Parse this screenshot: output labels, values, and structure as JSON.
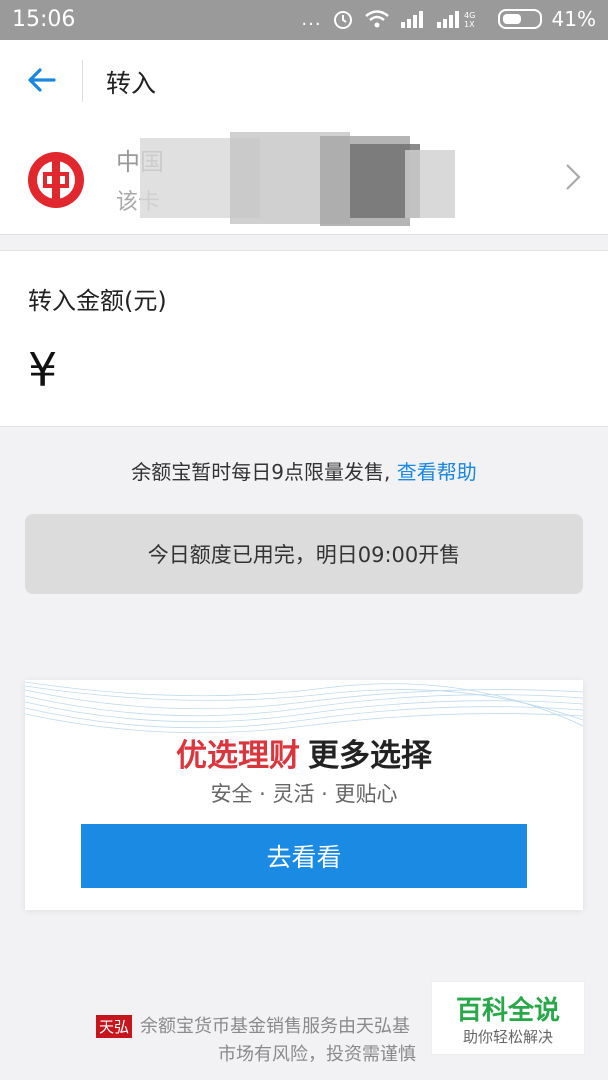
{
  "status_bar": {
    "time": "15:06",
    "dots": "...",
    "network": "4G\n1X",
    "battery": "41%",
    "battery_level": 0.41
  },
  "nav": {
    "title": "转入"
  },
  "bank_card": {
    "name": "中国",
    "sub": "该卡",
    "logo_color": "#e0282e"
  },
  "amount": {
    "label": "转入金额(元)",
    "currency": "¥",
    "value": ""
  },
  "notice": {
    "text": "余额宝暂时每日9点限量发售,",
    "link": "查看帮助"
  },
  "sold_out_button": {
    "label": "今日额度已用完，明日09:00开售"
  },
  "promo": {
    "title_red": "优选理财",
    "title_dark": "更多选择",
    "subtitle": "安全 · 灵活 · 更贴心",
    "button": "去看看",
    "accent": "#1a8ae3"
  },
  "footer": {
    "badge": "天弘",
    "line1": "余额宝货币基金销售服务由天弘基",
    "line2": "市场有风险，投资需谨慎"
  },
  "watermark": {
    "main": "百科全说",
    "sub": "助你轻松解决"
  }
}
